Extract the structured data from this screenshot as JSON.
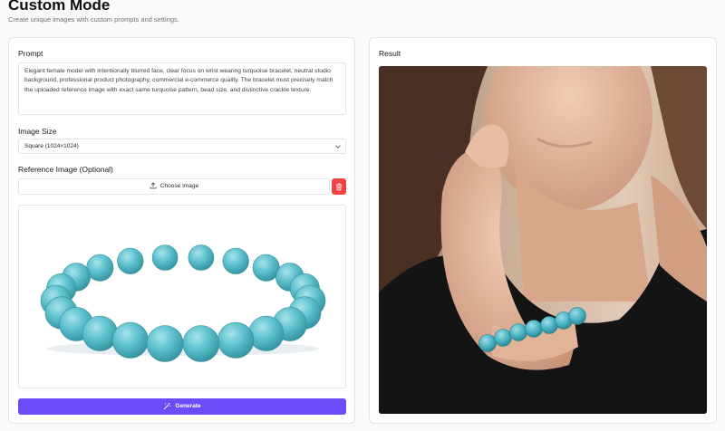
{
  "header": {
    "title": "Custom Mode",
    "subtitle": "Create unique images with custom prompts and settings."
  },
  "form": {
    "prompt_label": "Prompt",
    "prompt_value": "Elegant female model with intentionally blurred face, clear focus on wrist wearing turquoise bracelet, neutral studio background, professional product photography, commercial e-commerce quality. The bracelet must precisely match the uploaded reference image with exact same turquoise pattern, bead size, and distinctive crackle texture.",
    "image_size_label": "Image Size",
    "image_size_value": "Square (1024×1024)",
    "reference_label": "Reference Image (Optional)",
    "choose_image_label": "Choose Image",
    "generate_label": "Generate"
  },
  "result": {
    "label": "Result"
  },
  "colors": {
    "accent": "#6c4cf6",
    "danger": "#ef4444",
    "turquoise": "#4fb6c6"
  }
}
